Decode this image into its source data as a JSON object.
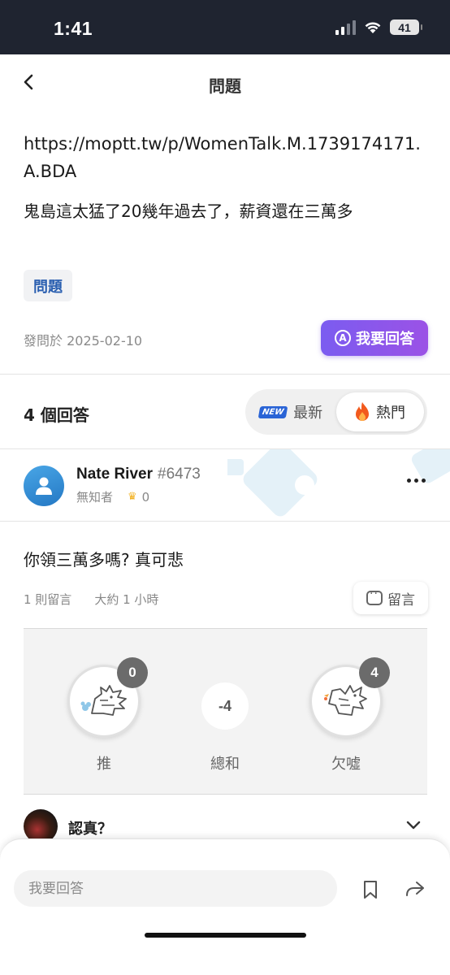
{
  "status_bar": {
    "time": "1:41",
    "battery": "41"
  },
  "header": {
    "title": "問題",
    "back_icon": "chevron-left-icon"
  },
  "question": {
    "link": "https://moptt.tw/p/WomenTalk.M.1739174171.A.BDA",
    "text": "鬼島這太猛了20幾年過去了，薪資還在三萬多",
    "tag": "問題",
    "posted": "發問於 2025-02-10",
    "answer_button": "我要回答"
  },
  "answers": {
    "count_label": "4 個回答",
    "sort_options": [
      "最新",
      "熱門"
    ],
    "sort_selected": "熱門",
    "new_badge": "NEW"
  },
  "answer": {
    "author": "Nate River",
    "author_id": "#6473",
    "author_title": "無知者",
    "crown_count": "0",
    "text": "你領三萬多嗎? 真可悲",
    "comment_count": "1 則留言",
    "time_ago": "大約 1 小時",
    "comment_button": "留言"
  },
  "votes": {
    "push_count": "0",
    "push_label": "推",
    "sum": "-4",
    "sum_label": "總和",
    "boo_count": "4",
    "boo_label": "欠噓"
  },
  "reply_preview": {
    "name": "認真？"
  },
  "bottom_bar": {
    "input_placeholder": "我要回答",
    "icons": [
      "bookmark-icon",
      "share-icon"
    ]
  },
  "colors": {
    "status_bar_bg": "#1f2430",
    "accent_purple": "#8a57ea",
    "tag_blue": "#2a5fb0",
    "vote_badge": "#6b6b6b"
  }
}
